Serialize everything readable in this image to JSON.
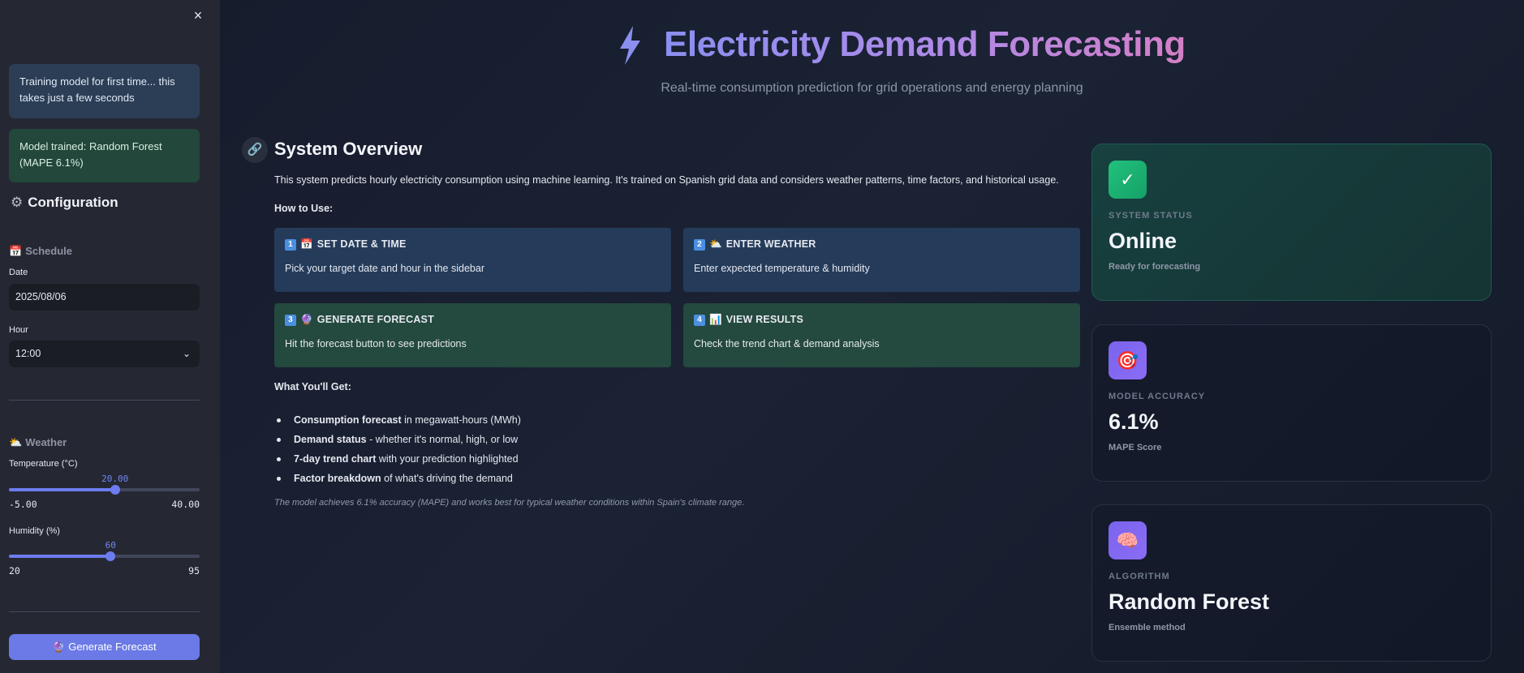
{
  "sidebar": {
    "close_icon": "×",
    "info_alert": "Training model for first time... this takes just a few seconds",
    "success_alert": "Model trained: Random Forest (MAPE 6.1%)",
    "config_heading": "Configuration",
    "schedule_heading": "Schedule",
    "date_label": "Date",
    "date_value": "2025/08/06",
    "hour_label": "Hour",
    "hour_value": "12:00",
    "weather_heading": "Weather",
    "temperature": {
      "label": "Temperature (°C)",
      "value": "20.00",
      "min": "-5.00",
      "max": "40.00",
      "fraction": 0.556
    },
    "humidity": {
      "label": "Humidity (%)",
      "value": "60",
      "min": "20",
      "max": "95",
      "fraction": 0.533
    },
    "generate_button": "Generate Forecast"
  },
  "header": {
    "title": "Electricity Demand Forecasting",
    "subtitle": "Real-time consumption prediction for grid operations and energy planning"
  },
  "overview": {
    "title": "System Overview",
    "description": "This system predicts hourly electricity consumption using machine learning. It's trained on Spanish grid data and considers weather patterns, time factors, and historical usage.",
    "how_to_use": "How to Use:",
    "steps": [
      {
        "num": "1",
        "title": "SET DATE & TIME",
        "text": "Pick your target date and hour in the sidebar"
      },
      {
        "num": "2",
        "title": "ENTER WEATHER",
        "text": "Enter expected temperature & humidity"
      },
      {
        "num": "3",
        "title": "GENERATE FORECAST",
        "text": "Hit the forecast button to see predictions"
      },
      {
        "num": "4",
        "title": "VIEW RESULTS",
        "text": "Check the trend chart & demand analysis"
      }
    ],
    "what_you_get": "What You'll Get:",
    "bullets": [
      {
        "bold": "Consumption forecast",
        "rest": " in megawatt-hours (MWh)"
      },
      {
        "bold": "Demand status",
        "rest": " - whether it's normal, high, or low"
      },
      {
        "bold": "7-day trend chart",
        "rest": " with your prediction highlighted"
      },
      {
        "bold": "Factor breakdown",
        "rest": " of what's driving the demand"
      }
    ],
    "note": "The model achieves 6.1% accuracy (MAPE) and works best for typical weather conditions within Spain's climate range."
  },
  "cards": {
    "status": {
      "icon": "✓",
      "label": "SYSTEM STATUS",
      "value": "Online",
      "note": "Ready for forecasting"
    },
    "accuracy": {
      "icon": "🎯",
      "label": "MODEL ACCURACY",
      "value": "6.1%",
      "note": "MAPE Score"
    },
    "algorithm": {
      "icon": "🧠",
      "label": "ALGORITHM",
      "value": "Random Forest",
      "note": "Ensemble method"
    }
  },
  "colors": {
    "accent": "#6b7ae6",
    "success": "#22c17c",
    "title_gradient_start": "#8a8ff0",
    "title_gradient_end": "#d47fc6"
  }
}
